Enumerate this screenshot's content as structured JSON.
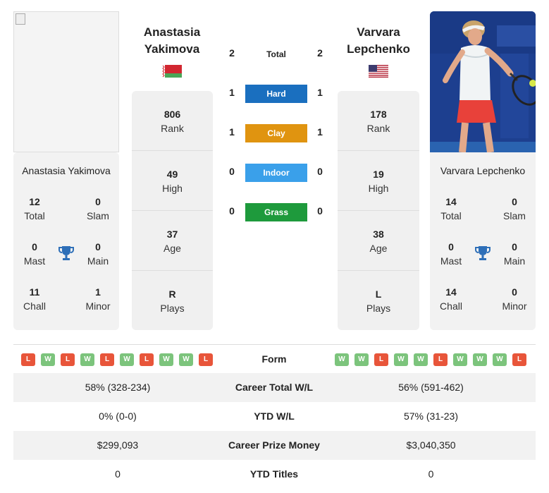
{
  "left_player": {
    "name_line1": "Anastasia",
    "name_line2": "Yakimova",
    "full_name": "Anastasia Yakimova",
    "flag": "belarus-flag",
    "total": "12",
    "total_label": "Total",
    "slam": "0",
    "slam_label": "Slam",
    "mast": "0",
    "mast_label": "Mast",
    "main": "0",
    "main_label": "Main",
    "chall": "11",
    "chall_label": "Chall",
    "minor": "1",
    "minor_label": "Minor",
    "rank": "806",
    "rank_label": "Rank",
    "high": "49",
    "high_label": "High",
    "age": "37",
    "age_label": "Age",
    "plays": "R",
    "plays_label": "Plays"
  },
  "right_player": {
    "name_line1": "Varvara",
    "name_line2": "Lepchenko",
    "full_name": "Varvara Lepchenko",
    "flag": "usa-flag",
    "total": "14",
    "total_label": "Total",
    "slam": "0",
    "slam_label": "Slam",
    "mast": "0",
    "mast_label": "Mast",
    "main": "0",
    "main_label": "Main",
    "chall": "14",
    "chall_label": "Chall",
    "minor": "0",
    "minor_label": "Minor",
    "rank": "178",
    "rank_label": "Rank",
    "high": "19",
    "high_label": "High",
    "age": "38",
    "age_label": "Age",
    "plays": "L",
    "plays_label": "Plays"
  },
  "h2h": {
    "total": {
      "label": "Total",
      "left": "2",
      "right": "2"
    },
    "hard": {
      "label": "Hard",
      "left": "1",
      "right": "1",
      "color": "#1a6fbf"
    },
    "clay": {
      "label": "Clay",
      "left": "1",
      "right": "1",
      "color": "#e09410"
    },
    "indoor": {
      "label": "Indoor",
      "left": "0",
      "right": "0",
      "color": "#3aa0ea"
    },
    "grass": {
      "label": "Grass",
      "left": "0",
      "right": "0",
      "color": "#1e9a3c"
    }
  },
  "form": {
    "label": "Form",
    "left": [
      "L",
      "W",
      "L",
      "W",
      "L",
      "W",
      "L",
      "W",
      "W",
      "L"
    ],
    "right": [
      "W",
      "W",
      "L",
      "W",
      "W",
      "L",
      "W",
      "W",
      "W",
      "L"
    ],
    "win_color": "#7cc47c",
    "loss_color": "#e8553a"
  },
  "stats": [
    {
      "label": "Career Total W/L",
      "left": "58% (328-234)",
      "right": "56% (591-462)"
    },
    {
      "label": "YTD W/L",
      "left": "0% (0-0)",
      "right": "57% (31-23)"
    },
    {
      "label": "Career Prize Money",
      "left": "$299,093",
      "right": "$3,040,350"
    },
    {
      "label": "YTD Titles",
      "left": "0",
      "right": "0"
    }
  ]
}
